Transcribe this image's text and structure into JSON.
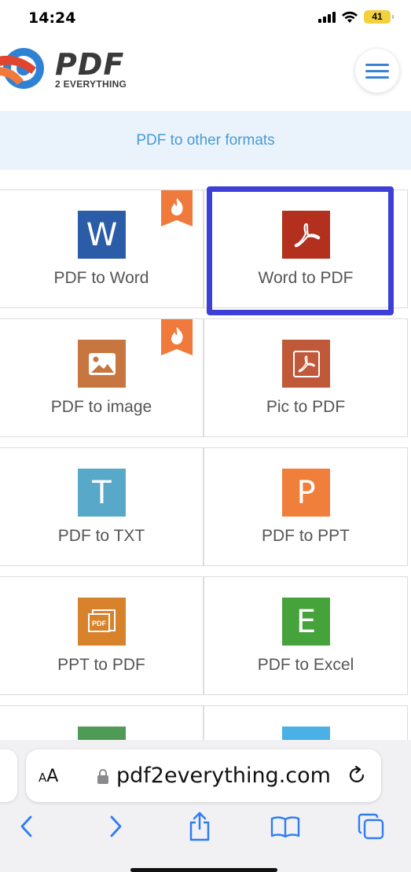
{
  "status_bar": {
    "time": "14:24",
    "battery": "41"
  },
  "header": {
    "logo_title": "PDF",
    "logo_subtitle": "2 EVERYTHING",
    "menu_icon": "hamburger-menu-icon"
  },
  "banner": {
    "text": "PDF to other formats"
  },
  "tools": [
    {
      "label": "PDF to Word",
      "icon": "word-icon",
      "color": "#2b5ca8",
      "hot": true
    },
    {
      "label": "Word to PDF",
      "icon": "pdf-icon",
      "color": "#b3301f",
      "hot": false,
      "highlighted": true
    },
    {
      "label": "PDF to image",
      "icon": "image-icon",
      "color": "#c8763f",
      "hot": true
    },
    {
      "label": "Pic to PDF",
      "icon": "pic-pdf-icon",
      "color": "#c0583a",
      "hot": false
    },
    {
      "label": "PDF to TXT",
      "icon": "txt-icon",
      "color": "#58a9c9",
      "hot": false
    },
    {
      "label": "PDF to PPT",
      "icon": "ppt-icon",
      "color": "#ef7f3a",
      "hot": false
    },
    {
      "label": "PPT to PDF",
      "icon": "ppt-pdf-icon",
      "color": "#d8822b",
      "hot": false
    },
    {
      "label": "PDF to Excel",
      "icon": "excel-icon",
      "color": "#46a23a",
      "hot": false
    }
  ],
  "tool_letters": {
    "word": "W",
    "txt": "T",
    "ppt": "P",
    "excel": "E",
    "pdf_tag": "PDF"
  },
  "hot_badge_color": "#f07a3c",
  "highlight_color": "#3d3fd6",
  "browser": {
    "text_size_button": "AA",
    "url": "pdf2everything.com",
    "nav_icons": [
      "back-icon",
      "forward-icon",
      "share-icon",
      "bookmarks-icon",
      "tabs-icon"
    ]
  }
}
